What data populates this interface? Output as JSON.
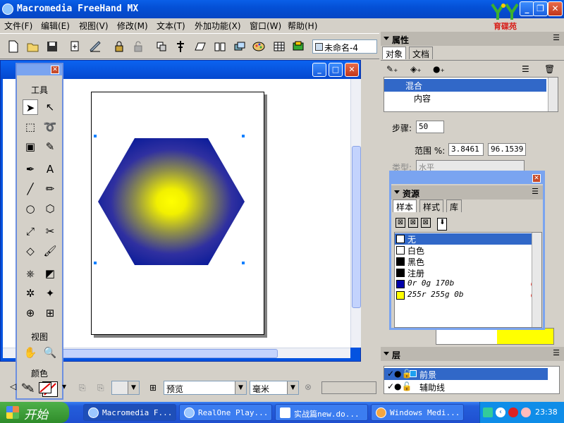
{
  "app": {
    "title": "Macromedia FreeHand MX",
    "logo_text": "育碟苑"
  },
  "menu": [
    "文件(F)",
    "编辑(E)",
    "视图(V)",
    "修改(M)",
    "文本(T)",
    "外加功能(X)",
    "窗口(W)",
    "帮助(H)"
  ],
  "toolbar": {
    "document_name": "未命名-4"
  },
  "tools_panel": {
    "tools_label": "工具",
    "view_label": "视图",
    "color_label": "颜色"
  },
  "properties_panel": {
    "title": "属性",
    "tabs": [
      "对象",
      "文档"
    ],
    "tree": [
      "混合",
      "内容"
    ],
    "steps_label": "步骤:",
    "steps_value": "50",
    "range_label": "范围 %:",
    "range_start": "3.8461",
    "range_end": "96.1539",
    "type_label": "类型:",
    "type_value": "水平"
  },
  "swatches_panel": {
    "title": "资源",
    "tabs": [
      "样本",
      "样式",
      "库"
    ],
    "items": [
      {
        "name": "无",
        "color": "none"
      },
      {
        "name": "白色",
        "color": "#ffffff"
      },
      {
        "name": "黑色",
        "color": "#000000"
      },
      {
        "name": "注册",
        "color": "#000000"
      },
      {
        "name": "0r 0g 170b",
        "color": "#0000aa"
      },
      {
        "name": "255r 255g 0b",
        "color": "#ffff00"
      }
    ]
  },
  "layers_panel": {
    "title": "层",
    "layers": [
      "前景",
      "辅助线"
    ]
  },
  "status": {
    "preview_mode": "预览",
    "units": "毫米"
  },
  "taskbar": {
    "start_label": "开始",
    "tasks": [
      "Macromedia F...",
      "RealOne Play...",
      "实战篇new.do...",
      "Windows Medi..."
    ],
    "clock": "23:38"
  },
  "colors": {
    "hex_outer": "#0d1d9a",
    "hex_center": "#ffff00",
    "selection_blue": "#3168c8"
  }
}
